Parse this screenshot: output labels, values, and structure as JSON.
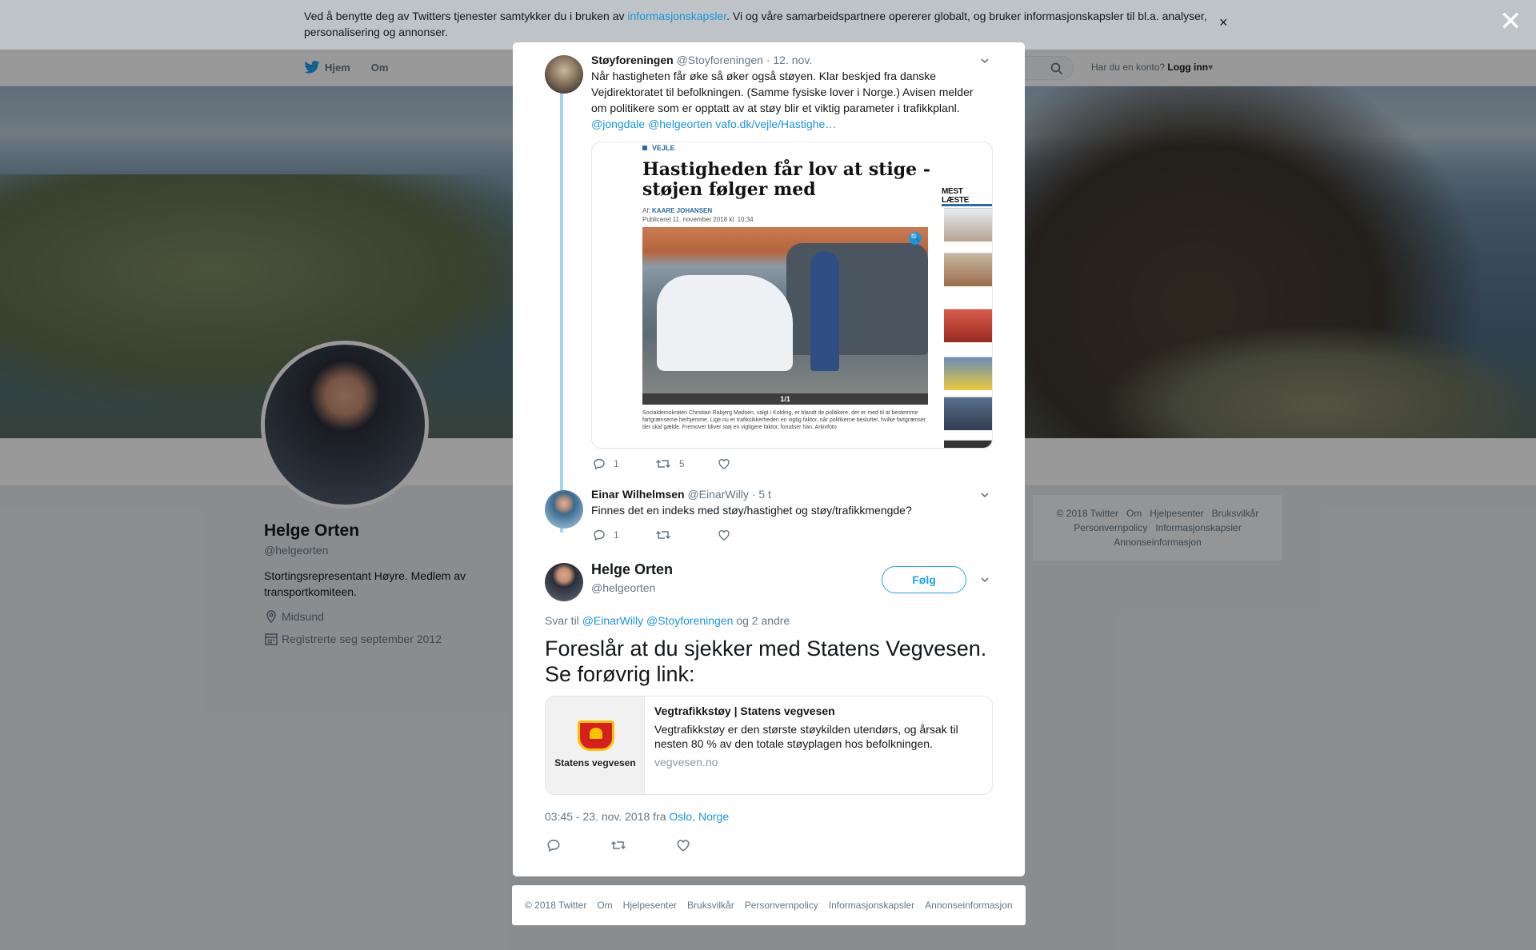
{
  "cookie_banner": {
    "text_before": "Ved å benytte deg av Twitters tjenester samtykker du i bruken av ",
    "link": "informasjonskapsler",
    "text_after": ". Vi og våre samarbeidspartnere opererer globalt, og bruker informasjonskapsler til bl.a. analyser, personalisering og annonser.",
    "close": "×"
  },
  "modal_close": "✕",
  "topbar": {
    "nav": [
      {
        "label": "Hjem",
        "icon": "twitter-bird-icon"
      },
      {
        "label": "Om"
      }
    ],
    "search_icon": "search-icon",
    "login_prompt": "Har du en konto?",
    "login_label": "Logg inn"
  },
  "profile": {
    "name": "Helge Orten",
    "handle": "@helgeorten",
    "bio": "Stortingsrepresentant Høyre. Medlem av transportkomiteen.",
    "location": "Midsund",
    "joined": "Registrerte seg september 2012"
  },
  "side_footer": {
    "links": [
      "© 2018 Twitter",
      "Om",
      "Hjelpesenter",
      "Bruksvilkår",
      "Personvernpolicy",
      "Informasjonskapsler",
      "Annonseinformasjon"
    ]
  },
  "thread": [
    {
      "name": "Støyforeningen",
      "handle": "@Stoyforeningen",
      "time": "· 12. nov.",
      "text": "Når hastigheten får øke så øker også støyen. Klar beskjed fra danske Vejdirektoratet til befolkningen.  (Samme fysiske lover i Norge.) Avisen melder om politikere som er opptatt av at støy blir et viktig parameter i trafikkplanl.",
      "links": "@jongdale @helgeorten  vafo.dk/vejle/Hastighe…",
      "media": {
        "tag": "VEJLE",
        "headline": "Hastigheden får lov at stige - støjen følger med",
        "byline_prefix": "Af: ",
        "byline_author": "KAARE JOHANSEN",
        "published": "Publiceret 11. november 2018 kl. 10:34",
        "pager": "1/1",
        "caption": "Socialdemokraten Christian Rabjerg Madsen, valgt i Kolding, er blandt de politikere, der er med til at bestemme fartgrænserne herhjemme. Lige nu er trafiksikkerheden en vigtig faktor, når politikerne beslutter, hvilke fartgrænser der skal gælde. Fremover bliver støj en vigtigere faktor, forudser han. Arkivfoto",
        "sidebar_title": "MEST LÆSTE"
      },
      "replies": "1",
      "retweets": "5",
      "likes": ""
    },
    {
      "name": "Einar Wilhelmsen",
      "handle": "@EinarWilly",
      "time": "· 5 t",
      "text": "Finnes det en indeks med støy/hastighet og støy/trafikkmengde?",
      "replies": "1",
      "retweets": "",
      "likes": ""
    }
  ],
  "main_tweet": {
    "name": "Helge Orten",
    "handle": "@helgeorten",
    "follow_label": "Følg",
    "reply_to_prefix": "Svar til ",
    "reply_to_links": "@EinarWilly @Stoyforeningen",
    "reply_to_suffix": " og 2 andre",
    "text": "Foreslår at du sjekker med Statens Vegvesen. Se forøvrig link:",
    "card": {
      "logo_text": "Statens vegvesen",
      "title": "Vegtrafikkstøy | Statens vegvesen",
      "description": "Vegtrafikkstøy er den største støykilden utendørs, og årsak til nesten 80 % av den totale støyplagen hos befolkningen.",
      "domain": "vegvesen.no"
    },
    "timestamp": "03:45 - 23. nov. 2018 fra ",
    "location": "Oslo, Norge"
  },
  "modal_footer": {
    "links": [
      "© 2018 Twitter",
      "Om",
      "Hjelpesenter",
      "Bruksvilkår",
      "Personvernpolicy",
      "Informasjonskapsler",
      "Annonseinformasjon"
    ]
  }
}
